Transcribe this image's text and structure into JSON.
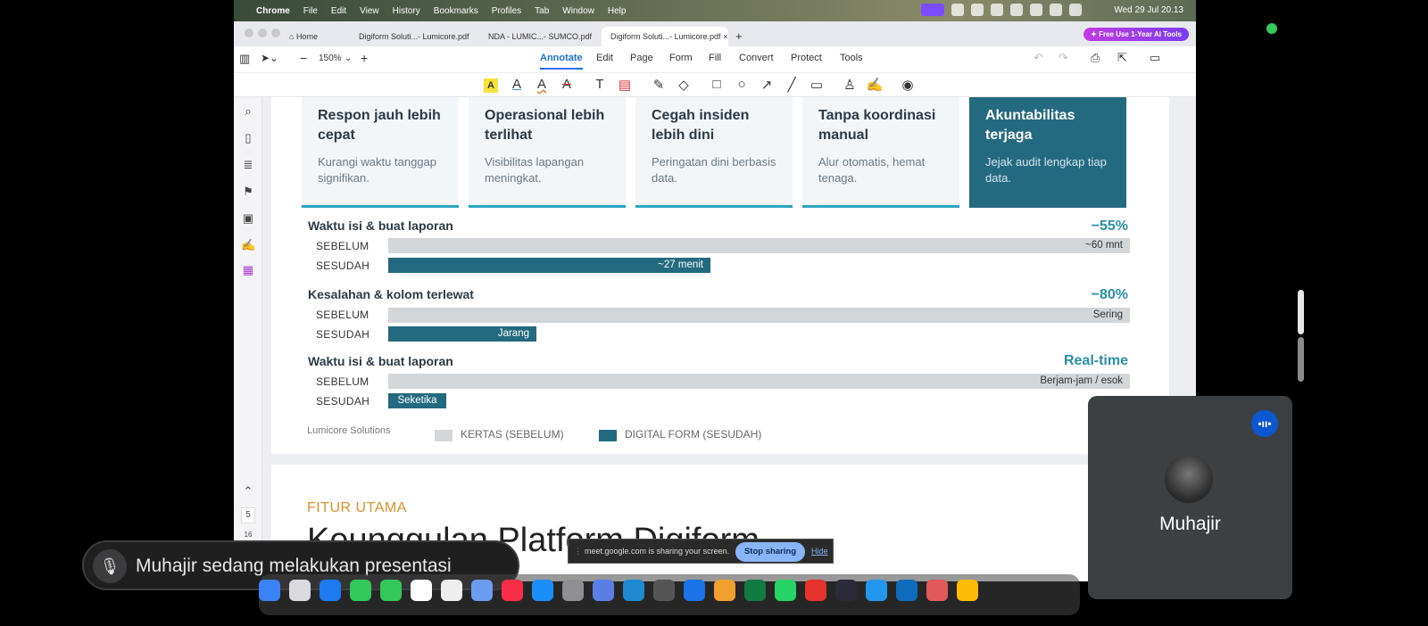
{
  "menubar": {
    "apple": "",
    "app": "Chrome",
    "items": [
      "File",
      "Edit",
      "View",
      "History",
      "Bookmarks",
      "Profiles",
      "Tab",
      "Window",
      "Help"
    ],
    "clock": "Wed 29 Jul  20.13"
  },
  "tabs": {
    "home": "Home",
    "tab1": "Digiform Soluti...- Lumicore.pdf",
    "tab2": "NDA - LUMIC...- SUMCO.pdf",
    "tab3": "Digiform Soluti...- Lumicore.pdf",
    "close": "×",
    "new": "+",
    "promo": "✦ Free Use 1-Year AI Tools"
  },
  "toolbar": {
    "zoom": "150%",
    "menus": [
      "Annotate",
      "Edit",
      "Page",
      "Form",
      "Fill",
      "Convert",
      "Protect",
      "Tools"
    ],
    "active_menu": "Annotate"
  },
  "cards": [
    {
      "title": "Respon jauh lebih cepat",
      "desc": "Kurangi waktu tanggap signifikan."
    },
    {
      "title": "Operasional lebih terlihat",
      "desc": "Visibilitas lapangan meningkat."
    },
    {
      "title": "Cegah insiden lebih dini",
      "desc": "Peringatan dini berbasis data."
    },
    {
      "title": "Tanpa koordinasi manual",
      "desc": "Alur otomatis, hemat tenaga."
    },
    {
      "title": "Akuntabilitas terjaga",
      "desc": "Jejak audit lengkap tiap data."
    }
  ],
  "metrics": [
    {
      "title": "Waktu isi & buat laporan",
      "delta": "−55%",
      "before_label": "SEBELUM",
      "after_label": "SESUDAH",
      "before_text": "~60 mnt",
      "after_text": "~27 menit",
      "after_fraction": 0.435
    },
    {
      "title": "Kesalahan & kolom terlewat",
      "delta": "−80%",
      "before_label": "SEBELUM",
      "after_label": "SESUDAH",
      "before_text": "Sering",
      "after_text": "Jarang",
      "after_fraction": 0.2
    },
    {
      "title": "Waktu isi & buat laporan",
      "delta": "Real-time",
      "before_label": "SEBELUM",
      "after_label": "SESUDAH",
      "before_text": "Berjam-jam / esok",
      "after_text": "Seketika",
      "after_fraction": 0.078
    }
  ],
  "legend": {
    "brand": "Lumicore Solutions",
    "before": "KERTAS (SEBELUM)",
    "after": "DIGITAL FORM (SESUDAH)"
  },
  "page2": {
    "eyebrow": "FITUR UTAMA",
    "heading": "Keunggulan Platform Digiform"
  },
  "sidebar": {
    "page_num": "5",
    "page_total": "16"
  },
  "meet": {
    "presenting": "Muhajir sedang melakukan presentasi",
    "share_text": "meet.google.com is sharing your screen.",
    "stop": "Stop sharing",
    "hide": "Hide",
    "participant": "Muhajir"
  },
  "colors": {
    "teal": "#236a80",
    "accent": "#2a8fa6",
    "grey_bar": "#d3d6d9"
  }
}
